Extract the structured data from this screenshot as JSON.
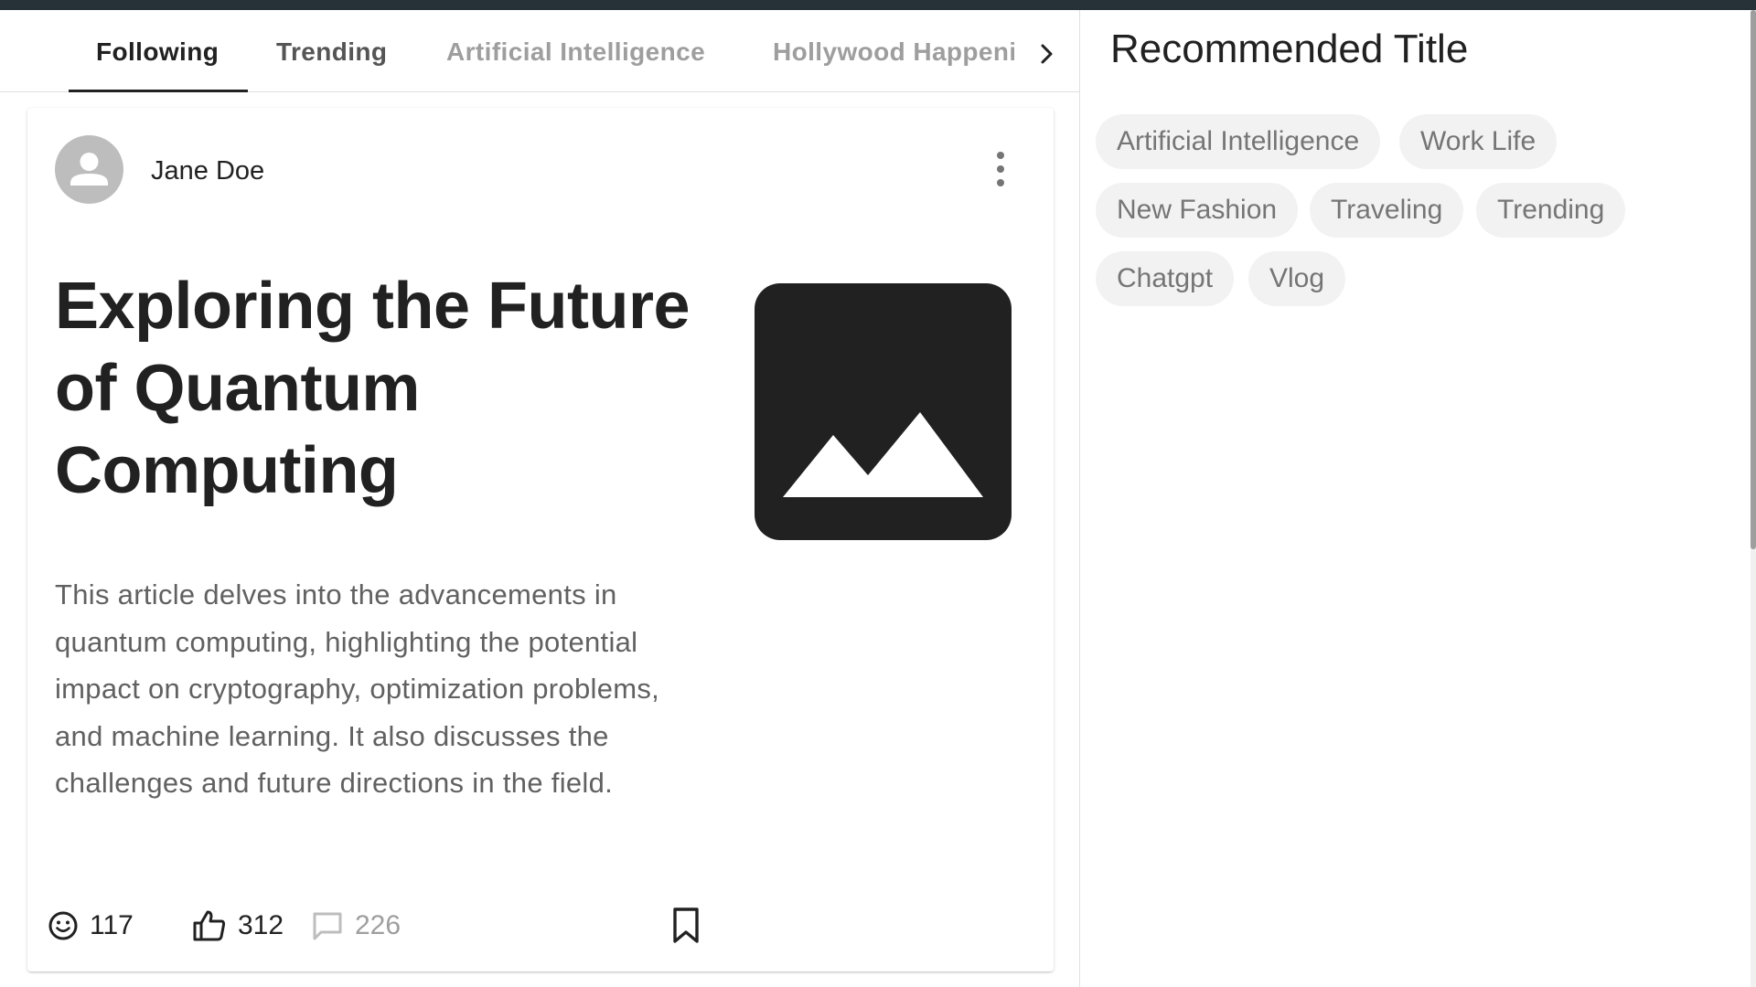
{
  "tabs": [
    {
      "label": "Following",
      "state": "active"
    },
    {
      "label": "Trending",
      "state": "normal"
    },
    {
      "label": "Artificial Intelligence",
      "state": "muted"
    },
    {
      "label": "Hollywood Happenings",
      "state": "muted"
    }
  ],
  "tab_next_icon": "chevron-right-icon",
  "post": {
    "author": "Jane Doe",
    "avatar_icon": "person-icon",
    "menu_icon": "more-vert-icon",
    "title": "Exploring the Future of Quantum Computing",
    "thumbnail_icon": "image-icon",
    "description": "This article delves into the advancements in quantum computing, highlighting the potential impact on cryptography, optimization problems, and machine learning. It also discusses the challenges and future directions in the field.",
    "reactions": {
      "emoji_icon": "smiley-icon",
      "count": "117"
    },
    "likes": {
      "icon": "thumb-up-icon",
      "count": "312"
    },
    "comments": {
      "icon": "comment-icon",
      "count": "226"
    },
    "bookmark_icon": "bookmark-icon"
  },
  "recommended": {
    "title": "Recommended Title",
    "chips": [
      "Artificial Intelligence",
      "Work Life",
      "New Fashion",
      "Traveling",
      "Trending",
      "Chatgpt",
      "Vlog"
    ]
  },
  "colors": {
    "topbar": "#263238",
    "text_primary": "#212121",
    "text_secondary": "#616161",
    "text_muted": "#9e9e9e",
    "chip_bg": "#f2f2f2"
  }
}
